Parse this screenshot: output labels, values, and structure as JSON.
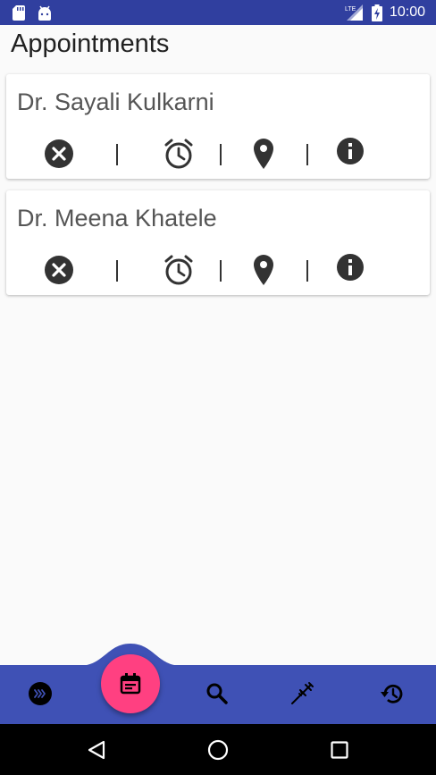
{
  "status_bar": {
    "time": "10:00",
    "network_label": "LTE",
    "icons": [
      "sd-card-icon",
      "android-icon",
      "signal-icon",
      "battery-icon"
    ]
  },
  "page": {
    "title": "Appointments"
  },
  "appointments": [
    {
      "doctor": "Dr. Sayali Kulkarni",
      "actions": [
        "cancel-icon",
        "alarm-icon",
        "location-icon",
        "info-icon"
      ]
    },
    {
      "doctor": "Dr. Meena Khatele",
      "actions": [
        "cancel-icon",
        "alarm-icon",
        "location-icon",
        "info-icon"
      ]
    }
  ],
  "bottom_nav": {
    "items": [
      "forward-icon",
      "appointment-calendar-icon",
      "search-icon",
      "syringe-icon",
      "history-icon"
    ],
    "active": "appointment-calendar-icon"
  },
  "system_nav": {
    "items": [
      "back-icon",
      "home-icon",
      "recents-icon"
    ]
  },
  "colors": {
    "primary": "#3f51b5",
    "primary_dark": "#303f9f",
    "accent": "#ff4081",
    "icon_dark": "#333333"
  }
}
